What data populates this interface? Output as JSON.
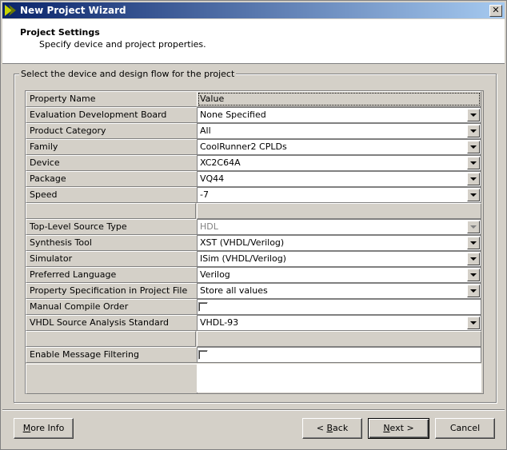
{
  "window": {
    "title": "New Project Wizard",
    "close_glyph": "✕",
    "logo_icon": "xilinx-logo-icon"
  },
  "header": {
    "title": "Project Settings",
    "subtitle": "Specify device and project properties."
  },
  "group": {
    "legend": "Select the device and design flow for the project"
  },
  "grid": {
    "col_name": "Property Name",
    "col_value": "Value",
    "rows": [
      {
        "name": "Evaluation Development Board",
        "value": "None Specified",
        "type": "dropdown"
      },
      {
        "name": "Product Category",
        "value": "All",
        "type": "dropdown"
      },
      {
        "name": "Family",
        "value": "CoolRunner2 CPLDs",
        "type": "dropdown"
      },
      {
        "name": "Device",
        "value": "XC2C64A",
        "type": "dropdown"
      },
      {
        "name": "Package",
        "value": "VQ44",
        "type": "dropdown"
      },
      {
        "name": "Speed",
        "value": "-7",
        "type": "dropdown"
      },
      {
        "name": "",
        "value": "",
        "type": "blank"
      },
      {
        "name": "Top-Level Source Type",
        "value": "HDL",
        "type": "dropdown-disabled"
      },
      {
        "name": "Synthesis Tool",
        "value": "XST (VHDL/Verilog)",
        "type": "dropdown"
      },
      {
        "name": "Simulator",
        "value": "ISim (VHDL/Verilog)",
        "type": "dropdown"
      },
      {
        "name": "Preferred Language",
        "value": "Verilog",
        "type": "dropdown"
      },
      {
        "name": "Property Specification in Project File",
        "value": "Store all values",
        "type": "dropdown"
      },
      {
        "name": "Manual Compile Order",
        "value": "",
        "type": "checkbox"
      },
      {
        "name": "VHDL Source Analysis Standard",
        "value": "VHDL-93",
        "type": "dropdown"
      },
      {
        "name": "",
        "value": "",
        "type": "blank"
      },
      {
        "name": "Enable Message Filtering",
        "value": "",
        "type": "checkbox"
      }
    ]
  },
  "buttons": {
    "more_info": {
      "label_pre": "",
      "label_u": "M",
      "label_post": "ore Info"
    },
    "back": {
      "label_pre": "< ",
      "label_u": "B",
      "label_post": "ack"
    },
    "next": {
      "label_pre": "",
      "label_u": "N",
      "label_post": "ext >"
    },
    "cancel": {
      "label": "Cancel"
    }
  }
}
